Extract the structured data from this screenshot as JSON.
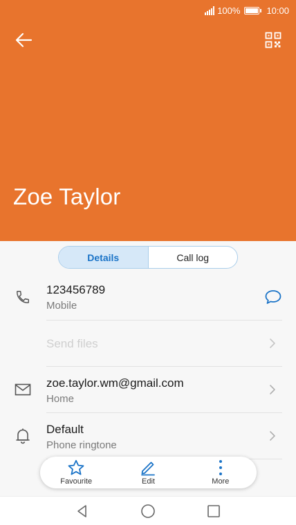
{
  "status_bar": {
    "battery_percent": "100%",
    "time": "10:00"
  },
  "header": {
    "contact_name": "Zoe Taylor",
    "background_color": "#e8742d"
  },
  "tabs": [
    {
      "label": "Details",
      "active": true
    },
    {
      "label": "Call log",
      "active": false
    }
  ],
  "rows": {
    "phone": {
      "number": "123456789",
      "type": "Mobile",
      "icon": "phone-icon",
      "action_icon": "message-icon"
    },
    "send_files": {
      "label": "Send files",
      "disabled": true
    },
    "email": {
      "address": "zoe.taylor.wm@gmail.com",
      "type": "Home",
      "icon": "mail-icon"
    },
    "ringtone": {
      "value": "Default",
      "label": "Phone ringtone",
      "icon": "bell-icon"
    }
  },
  "actions": [
    {
      "label": "Favourite",
      "icon": "star-icon"
    },
    {
      "label": "Edit",
      "icon": "pencil-icon"
    },
    {
      "label": "More",
      "icon": "more-vertical-icon"
    }
  ],
  "colors": {
    "accent_blue": "#1a73c7",
    "header_orange": "#e8742d"
  }
}
